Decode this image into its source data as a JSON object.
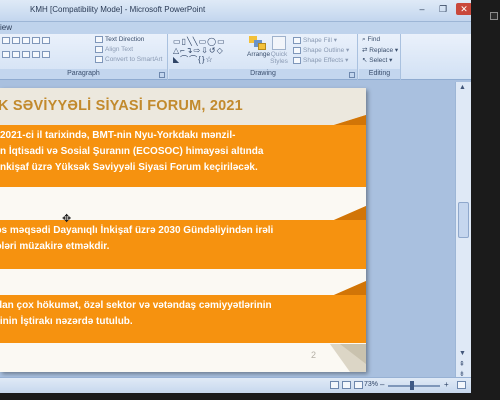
{
  "window": {
    "title": "KMH [Compatibility Mode] - Microsoft PowerPoint"
  },
  "tabs": {
    "partial_tab": "iew"
  },
  "ribbon": {
    "paragraph": {
      "label": "Paragraph",
      "text_direction": "Text Direction",
      "align_text": "Align Text",
      "convert_smartart": "Convert to SmartArt"
    },
    "drawing": {
      "label": "Drawing",
      "arrange": "Arrange",
      "quick_styles": "Quick Styles",
      "shape_fill": "Shape Fill",
      "shape_outline": "Shape Outline",
      "shape_effects": "Shape Effects"
    },
    "editing": {
      "label": "Editing",
      "find": "Find",
      "replace": "Replace",
      "select": "Select"
    }
  },
  "slide": {
    "title": "K SƏVİYYƏLİ SİYASİ FORUM, 2021",
    "number": "2",
    "blocks": [
      {
        "lines": [
          "2021-ci il tarixində, BMT-nin Nyu-Yorkdakı mənzil-",
          "n İqtisadi və Sosial Şuranın (ECOSOC) himayəsi altında",
          "nkişaf üzrə Yüksək Səviyyəli Siyasi Forum keçiriləcək."
        ]
      },
      {
        "lines": [
          "əs məqsədi Dayanıqlı İnkişaf üzrə 2030 Gündəliyindən irəli",
          "ələri müzakirə etməkdir."
        ]
      },
      {
        "lines": [
          "dan çox hökumət, özəl sektor və vətəndaş cəmiyyətlərinin",
          "rinin İştirakı nəzərdə tutulub."
        ]
      }
    ]
  },
  "status": {
    "zoom": "73%"
  },
  "colors": {
    "accent_orange": "#f6920f",
    "title_gold": "#c28a2d"
  }
}
